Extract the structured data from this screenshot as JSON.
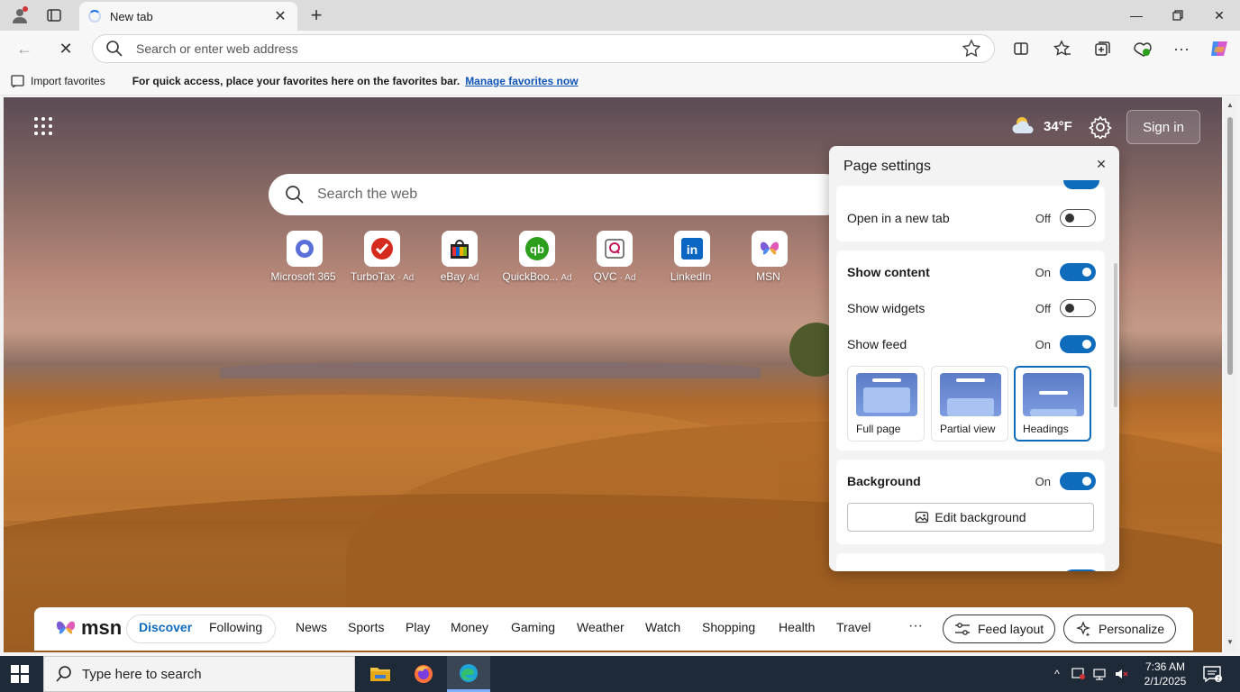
{
  "browser": {
    "tab_title": "New tab",
    "omnibox_placeholder": "Search or enter web address"
  },
  "favorites_bar": {
    "import_label": "Import favorites",
    "message": "For quick access, place your favorites here on the favorites bar.",
    "manage_link": "Manage favorites now"
  },
  "newtab": {
    "weather_temp": "34°F",
    "signin_label": "Sign in",
    "search_placeholder": "Search the web",
    "tiles": [
      {
        "name": "Microsoft 365",
        "ad": "",
        "color": "#5b6fd8"
      },
      {
        "name": "TurboTax",
        "ad": "· Ad",
        "color": "#d52b1e"
      },
      {
        "name": "eBay",
        "ad": "Ad",
        "color": "#222222"
      },
      {
        "name": "QuickBoo...",
        "ad": "Ad",
        "color": "#2ca01c"
      },
      {
        "name": "QVC",
        "ad": "· Ad",
        "color": "#555555"
      },
      {
        "name": "LinkedIn",
        "ad": "",
        "color": "#0a66c2"
      },
      {
        "name": "MSN",
        "ad": "",
        "color": "#7b5cd6"
      }
    ]
  },
  "page_settings": {
    "title": "Page settings",
    "open_new_tab": {
      "label": "Open in a new tab",
      "state": "Off"
    },
    "show_content": {
      "label": "Show content",
      "state": "On"
    },
    "show_widgets": {
      "label": "Show widgets",
      "state": "Off"
    },
    "show_feed": {
      "label": "Show feed",
      "state": "On"
    },
    "layouts": [
      "Full page",
      "Partial view",
      "Headings"
    ],
    "selected_layout": "Headings",
    "background": {
      "label": "Background",
      "state": "On"
    },
    "edit_background_label": "Edit background"
  },
  "msn_nav": {
    "logo_text": "msn",
    "items": [
      "Discover",
      "Following",
      "News",
      "Sports",
      "Play",
      "Money",
      "Gaming",
      "Weather",
      "Watch",
      "Shopping",
      "Health",
      "Travel"
    ],
    "active": "Discover",
    "more": "···",
    "feed_layout_label": "Feed layout",
    "personalize_label": "Personalize"
  },
  "taskbar": {
    "search_placeholder": "Type here to search",
    "time": "7:36 AM",
    "date": "2/1/2025"
  },
  "colors": {
    "accent": "#0f6cbd",
    "taskbar": "#1f2a38"
  }
}
